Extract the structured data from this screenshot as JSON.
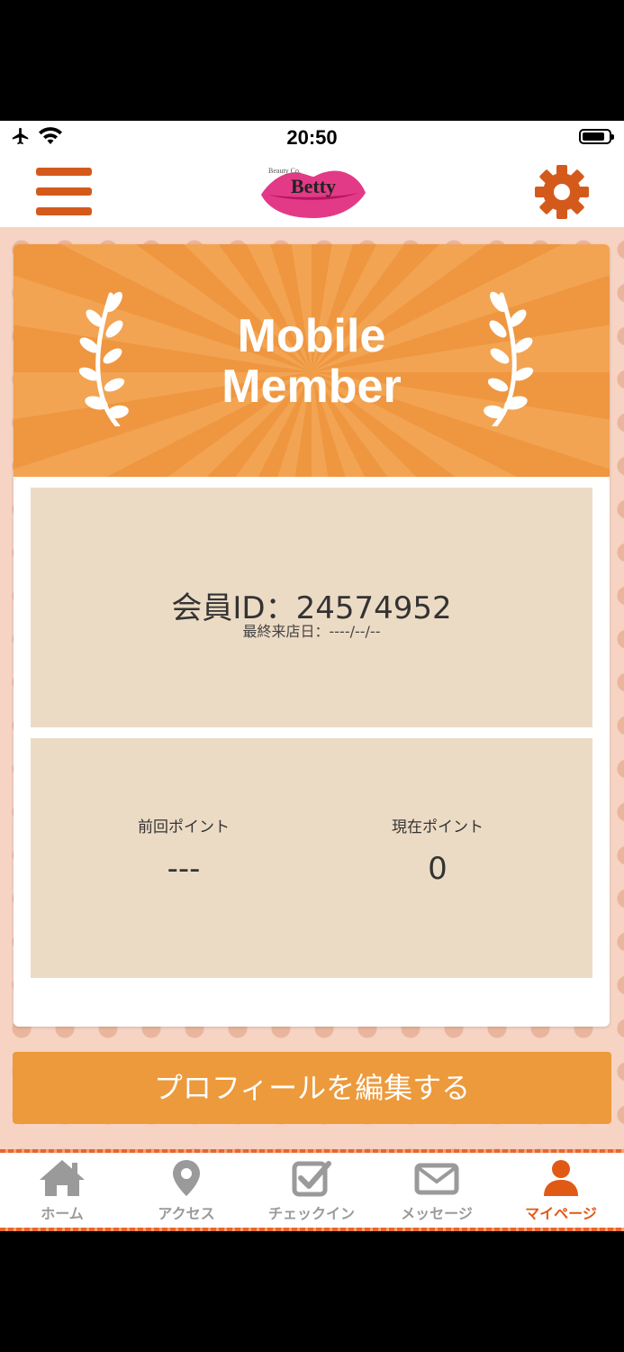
{
  "status_bar": {
    "time": "20:50"
  },
  "header": {
    "logo_text": "Betty",
    "logo_subtext": "Beauty Co."
  },
  "banner": {
    "title_line1": "Mobile",
    "title_line2": "Member"
  },
  "member": {
    "id_label": "会員ID：24574952",
    "last_visit": "最終来店日：----/--/--"
  },
  "points": {
    "previous_label": "前回ポイント",
    "previous_value": "---",
    "current_label": "現在ポイント",
    "current_value": "0"
  },
  "edit_profile_label": "プロフィールを編集する",
  "tabs": [
    {
      "label": "ホーム",
      "icon": "home-icon"
    },
    {
      "label": "アクセス",
      "icon": "map-pin-icon"
    },
    {
      "label": "チェックイン",
      "icon": "checkin-icon"
    },
    {
      "label": "メッセージ",
      "icon": "mail-icon"
    },
    {
      "label": "マイページ",
      "icon": "user-icon"
    }
  ],
  "colors": {
    "accent": "#d45a1c",
    "button": "#ec9a3c",
    "banner": "#ef9640",
    "panel": "#ecdbc4",
    "tab_active": "#e05a16",
    "tab_inactive": "#9a9a9a",
    "logo_lips": "#e23a86"
  }
}
